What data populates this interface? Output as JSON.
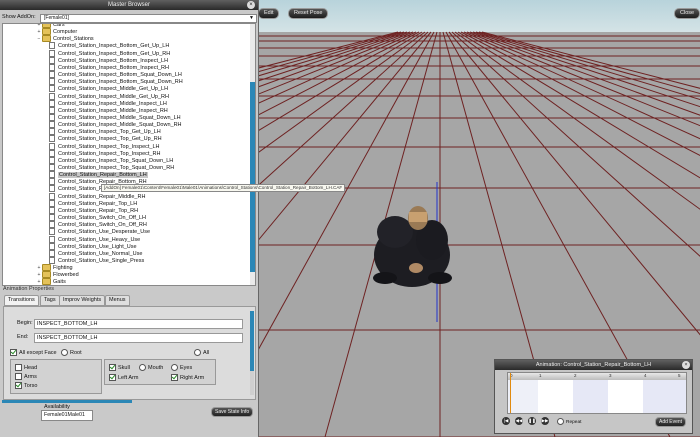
{
  "topbar": {
    "buttons": [
      "Edit",
      "Reset Pose",
      "Close"
    ]
  },
  "master_browser": {
    "title": "Master Browser",
    "close_glyph": "×",
    "show_addon_label": "Show AddOn:",
    "show_addon_value": "[Female01]",
    "tree": [
      {
        "label": "Cars",
        "type": "folder",
        "expanded": false,
        "level": 1
      },
      {
        "label": "Computer",
        "type": "folder",
        "expanded": false,
        "level": 1
      },
      {
        "label": "Control_Stations",
        "type": "folder",
        "expanded": true,
        "level": 1
      },
      {
        "label": "Control_Station_Inspect_Bottom_Get_Up_LH",
        "type": "file",
        "level": 2
      },
      {
        "label": "Control_Station_Inspect_Bottom_Get_Up_RH",
        "type": "file",
        "level": 2
      },
      {
        "label": "Control_Station_Inspect_Bottom_Inspect_LH",
        "type": "file",
        "level": 2
      },
      {
        "label": "Control_Station_Inspect_Bottom_Inspect_RH",
        "type": "file",
        "level": 2
      },
      {
        "label": "Control_Station_Inspect_Bottom_Squat_Down_LH",
        "type": "file",
        "level": 2
      },
      {
        "label": "Control_Station_Inspect_Bottom_Squat_Down_RH",
        "type": "file",
        "level": 2
      },
      {
        "label": "Control_Station_Inspect_Middle_Get_Up_LH",
        "type": "file",
        "level": 2
      },
      {
        "label": "Control_Station_Inspect_Middle_Get_Up_RH",
        "type": "file",
        "level": 2
      },
      {
        "label": "Control_Station_Inspect_Middle_Inspect_LH",
        "type": "file",
        "level": 2
      },
      {
        "label": "Control_Station_Inspect_Middle_Inspect_RH",
        "type": "file",
        "level": 2
      },
      {
        "label": "Control_Station_Inspect_Middle_Squat_Down_LH",
        "type": "file",
        "level": 2
      },
      {
        "label": "Control_Station_Inspect_Middle_Squat_Down_RH",
        "type": "file",
        "level": 2
      },
      {
        "label": "Control_Station_Inspect_Top_Get_Up_LH",
        "type": "file",
        "level": 2
      },
      {
        "label": "Control_Station_Inspect_Top_Get_Up_RH",
        "type": "file",
        "level": 2
      },
      {
        "label": "Control_Station_Inspect_Top_Inspect_LH",
        "type": "file",
        "level": 2
      },
      {
        "label": "Control_Station_Inspect_Top_Inspect_RH",
        "type": "file",
        "level": 2
      },
      {
        "label": "Control_Station_Inspect_Top_Squat_Down_LH",
        "type": "file",
        "level": 2
      },
      {
        "label": "Control_Station_Inspect_Top_Squat_Down_RH",
        "type": "file",
        "level": 2
      },
      {
        "label": "Control_Station_Repair_Bottom_LH",
        "type": "file",
        "level": 2,
        "selected": true
      },
      {
        "label": "Control_Station_Repair_Bottom_RH",
        "type": "file",
        "level": 2
      },
      {
        "label": "Control_Station_Repair_Middle_LH",
        "type": "file",
        "level": 2
      },
      {
        "label": "Control_Station_Repair_Middle_RH",
        "type": "file",
        "level": 2
      },
      {
        "label": "Control_Station_Repair_Top_LH",
        "type": "file",
        "level": 2
      },
      {
        "label": "Control_Station_Repair_Top_RH",
        "type": "file",
        "level": 2
      },
      {
        "label": "Control_Station_Switch_On_Off_LH",
        "type": "file",
        "level": 2
      },
      {
        "label": "Control_Station_Switch_On_Off_RH",
        "type": "file",
        "level": 2
      },
      {
        "label": "Control_Station_Use_Desperate_Use",
        "type": "file",
        "level": 2
      },
      {
        "label": "Control_Station_Use_Heavy_Use",
        "type": "file",
        "level": 2
      },
      {
        "label": "Control_Station_Use_Light_Use",
        "type": "file",
        "level": 2
      },
      {
        "label": "Control_Station_Use_Normal_Use",
        "type": "file",
        "level": 2
      },
      {
        "label": "Control_Station_Use_Single_Press",
        "type": "file",
        "level": 2
      },
      {
        "label": "Fighting",
        "type": "folder",
        "expanded": false,
        "level": 1
      },
      {
        "label": "Flowerbed",
        "type": "folder",
        "expanded": false,
        "level": 1
      },
      {
        "label": "Gaits",
        "type": "folder",
        "expanded": false,
        "level": 1
      }
    ],
    "tooltip": "[AddOn] Female01\\Content\\Female01\\Male01\\Animations\\Control_Stations\\Control_Station_Repair_Bottom_LH.CAF",
    "anim_props_label": "Animation Properties",
    "tabs": [
      "Transitions",
      "Tags",
      "Improv Weights",
      "Menus"
    ],
    "begin_label": "Begin:",
    "begin_value": "INSPECT_BOTTOM_LH",
    "end_label": "End:",
    "end_value": "INSPECT_BOTTOM_LH",
    "mask_options": [
      "All except Face",
      "Root",
      "All"
    ],
    "body_left": [
      "Head",
      "Arms",
      "Torso"
    ],
    "body_right": [
      "Skull",
      "Mouth",
      "Eyes",
      "Left Arm",
      "Right Arm"
    ],
    "availability_label": "Availability",
    "availability_value": "Female01Male01",
    "save_button": "Save State Info"
  },
  "timeline": {
    "title": "Animation: Control_Station_Repair_Bottom_LH",
    "close_glyph": "×",
    "ticks": [
      "0",
      "1",
      "2",
      "3",
      "4",
      "5"
    ],
    "controls": [
      "|◀",
      "◀◀",
      "❚❚",
      "▶▶"
    ],
    "repeat_label": "Repeat",
    "add_event": "Add Event"
  },
  "colors": {
    "accent": "#2b87b6",
    "floor": "#a6a6a6",
    "gridline": "#6e2222",
    "sky": "#c3d9df",
    "playhead": "#e08a10"
  },
  "icons": {
    "folder": "folder-icon",
    "file": "file-icon",
    "close": "close-icon"
  }
}
